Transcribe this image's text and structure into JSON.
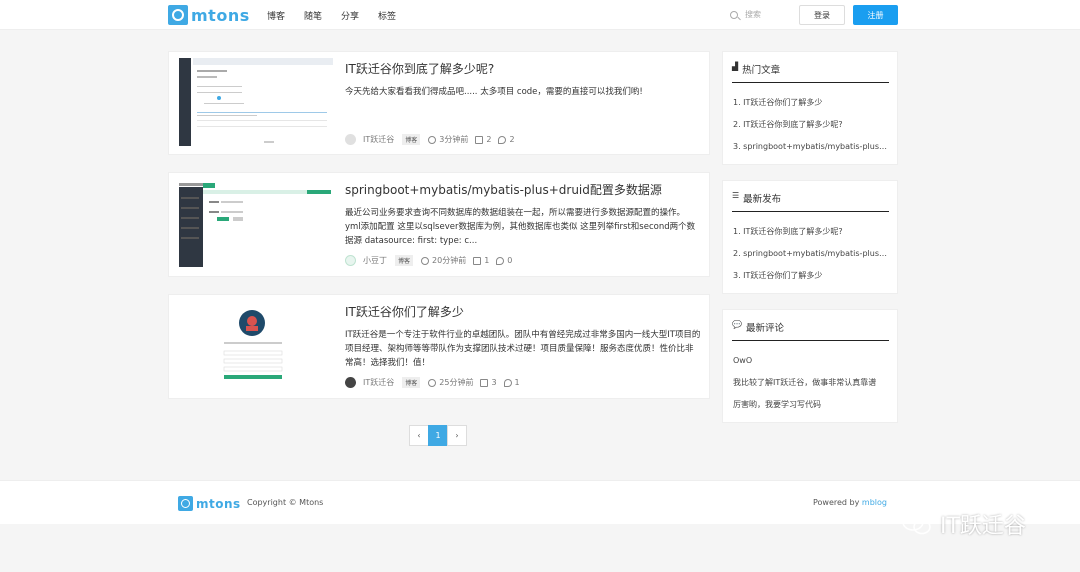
{
  "header": {
    "logo": "mtons",
    "nav": [
      "博客",
      "随笔",
      "分享",
      "标签"
    ],
    "search_placeholder": "搜索",
    "login": "登录",
    "register": "注册"
  },
  "posts": [
    {
      "title": "IT跃迁谷你到底了解多少呢?",
      "excerpt": "今天先给大家看看我们得成品吧..... 太多项目 code，需要的直接可以找我们哟!",
      "author": "IT跃迁谷",
      "tag": "博客",
      "time": "3分钟前",
      "views": "2",
      "comments": "2"
    },
    {
      "title": "springboot+mybatis/mybatis-plus+druid配置多数据源",
      "excerpt": "最近公司业务要求查询不同数据库的数据组装在一起，所以需要进行多数据源配置的操作。 yml添加配置 这里以sqlsever数据库为例，其他数据库也类似 这里列举first和second两个数据源 datasource: first: type: c...",
      "author": "小豆丁",
      "tag": "博客",
      "time": "20分钟前",
      "views": "1",
      "comments": "0"
    },
    {
      "title": "IT跃迁谷你们了解多少",
      "excerpt": "IT跃迁谷是一个专注于软件行业的卓越团队。团队中有曾经完成过非常多国内一线大型IT项目的项目经理、架构师等等带队作为支撑团队技术过硬！项目质量保障！服务态度优质！性价比非常高！选择我们！值！",
      "author": "IT跃迁谷",
      "tag": "博客",
      "time": "25分钟前",
      "views": "3",
      "comments": "1"
    }
  ],
  "pagination": {
    "prev": "‹",
    "current": "1",
    "next": "›"
  },
  "sidebar": {
    "hot": {
      "title": "热门文章",
      "items": [
        "1. IT跃迁谷你们了解多少",
        "2. IT跃迁谷你到底了解多少呢?",
        "3. springboot+mybatis/mybatis-plus+druid配置多数据源"
      ]
    },
    "latest": {
      "title": "最新发布",
      "items": [
        "1. IT跃迁谷你到底了解多少呢?",
        "2. springboot+mybatis/mybatis-plus+druid配置多数据源",
        "3. IT跃迁谷你们了解多少"
      ]
    },
    "comments": {
      "title": "最新评论",
      "items": [
        "OwO",
        "我比较了解IT跃迁谷，做事非常认真靠谱",
        "厉害哟，我要学习写代码"
      ]
    }
  },
  "footer": {
    "logo": "mtons",
    "copyright": "Copyright © Mtons",
    "powered_label": "Powered by",
    "powered_link": "mblog"
  },
  "watermark": "IT跃迁谷",
  "colors": {
    "accent": "#3fa9e4",
    "register": "#1a9ef0",
    "sidebar_rule": "#222222"
  }
}
